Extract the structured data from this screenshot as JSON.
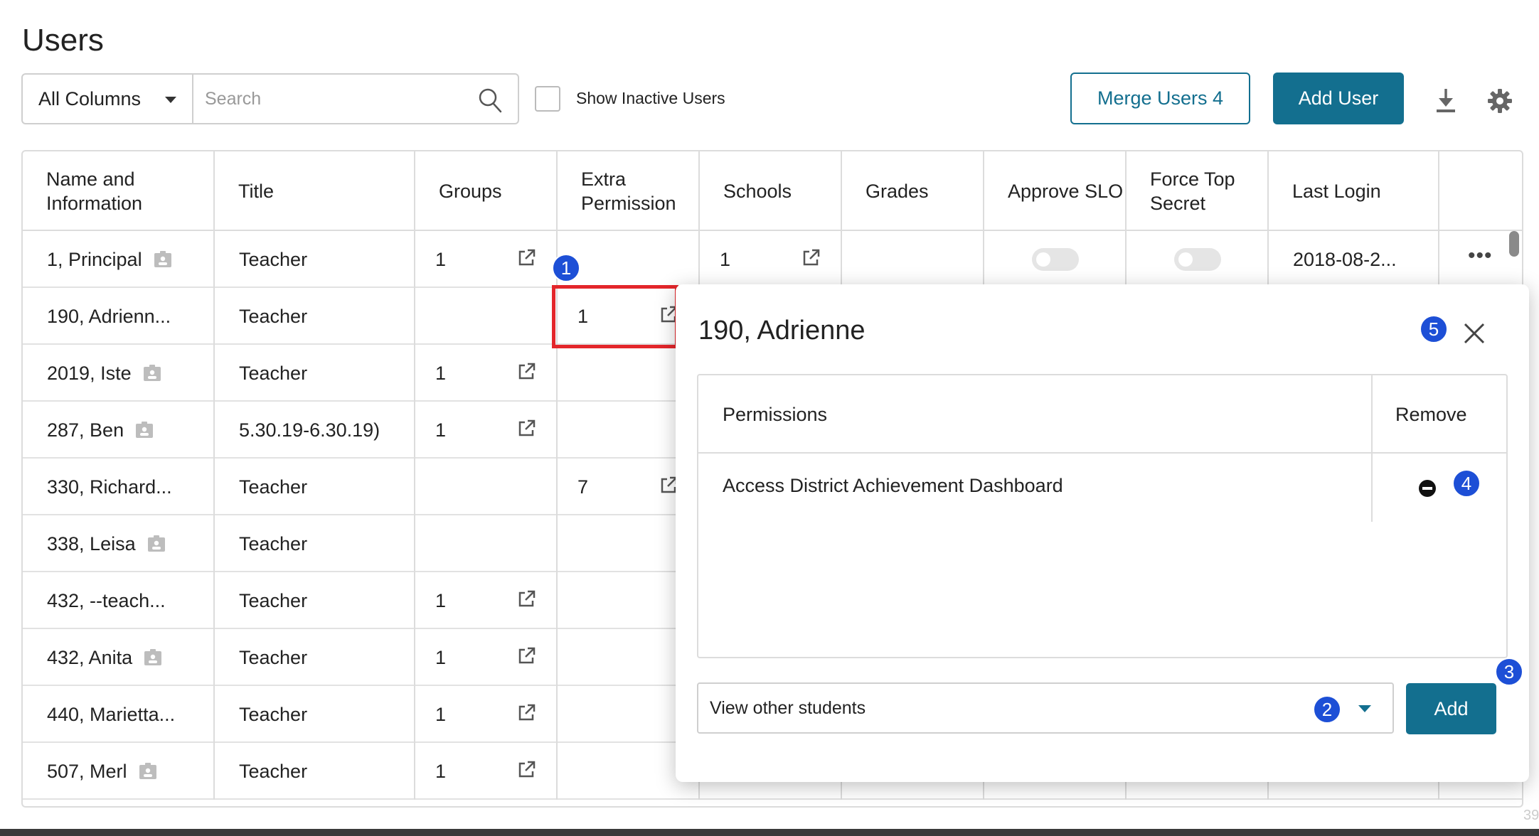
{
  "page": {
    "title": "Users"
  },
  "toolbar": {
    "column_filter": "All Columns",
    "search_placeholder": "Search",
    "search_value": "",
    "show_inactive_label": "Show Inactive Users",
    "show_inactive_checked": false,
    "merge_label": "Merge Users 4",
    "add_user_label": "Add User",
    "download_icon": "download-icon",
    "settings_icon": "gear-icon"
  },
  "table": {
    "columns": [
      "Name and Information",
      "Title",
      "Groups",
      "Extra Permission",
      "Schools",
      "Grades",
      "Approve SLO",
      "Force Top Secret",
      "Last Login"
    ],
    "rows": [
      {
        "name": "1, Principal",
        "id_icon": true,
        "title": "Teacher",
        "groups": "1",
        "extra": "",
        "schools": "1",
        "grades": "",
        "approve_slo": false,
        "force_top_secret": false,
        "last_login": "2018-08-2..."
      },
      {
        "name": "190, Adrienn...",
        "id_icon": false,
        "title": "Teacher",
        "groups": "",
        "extra": "1",
        "schools": "",
        "grades": "",
        "last_login": ""
      },
      {
        "name": "2019, Iste",
        "id_icon": true,
        "title": "Teacher",
        "groups": "1",
        "extra": "",
        "schools": "",
        "grades": "",
        "last_login": ""
      },
      {
        "name": "287, Ben",
        "id_icon": true,
        "title": "5.30.19-6.30.19)",
        "groups": "1",
        "extra": "",
        "schools": "",
        "grades": "",
        "last_login": ""
      },
      {
        "name": "330, Richard...",
        "id_icon": false,
        "title": "Teacher",
        "groups": "",
        "extra": "7",
        "schools": "",
        "grades": "",
        "last_login": ""
      },
      {
        "name": "338, Leisa",
        "id_icon": true,
        "title": "Teacher",
        "groups": "",
        "extra": "",
        "schools": "",
        "grades": "",
        "last_login": ""
      },
      {
        "name": "432, --teach...",
        "id_icon": false,
        "title": "Teacher",
        "groups": "1",
        "extra": "",
        "schools": "",
        "grades": "",
        "last_login": ""
      },
      {
        "name": "432, Anita",
        "id_icon": true,
        "title": "Teacher",
        "groups": "1",
        "extra": "",
        "schools": "",
        "grades": "",
        "last_login": ""
      },
      {
        "name": "440, Marietta...",
        "id_icon": false,
        "title": "Teacher",
        "groups": "1",
        "extra": "",
        "schools": "",
        "grades": "",
        "last_login": ""
      },
      {
        "name": "507, Merl",
        "id_icon": true,
        "title": "Teacher",
        "groups": "1",
        "extra": "",
        "schools": "",
        "grades": "",
        "last_login": ""
      }
    ]
  },
  "badges": {
    "b1": "1",
    "b2": "2",
    "b3": "3",
    "b4": "4",
    "b5": "5"
  },
  "modal": {
    "title": "190, Adrienne",
    "permissions_header": "Permissions",
    "remove_header": "Remove",
    "permissions": [
      "Access District Achievement Dashboard"
    ],
    "select_value": "View other students",
    "add_label": "Add"
  },
  "footer": {
    "page_number": "39"
  },
  "colors": {
    "accent": "#136f8f",
    "badge": "#1d4fd6",
    "highlight": "#e3262b"
  }
}
